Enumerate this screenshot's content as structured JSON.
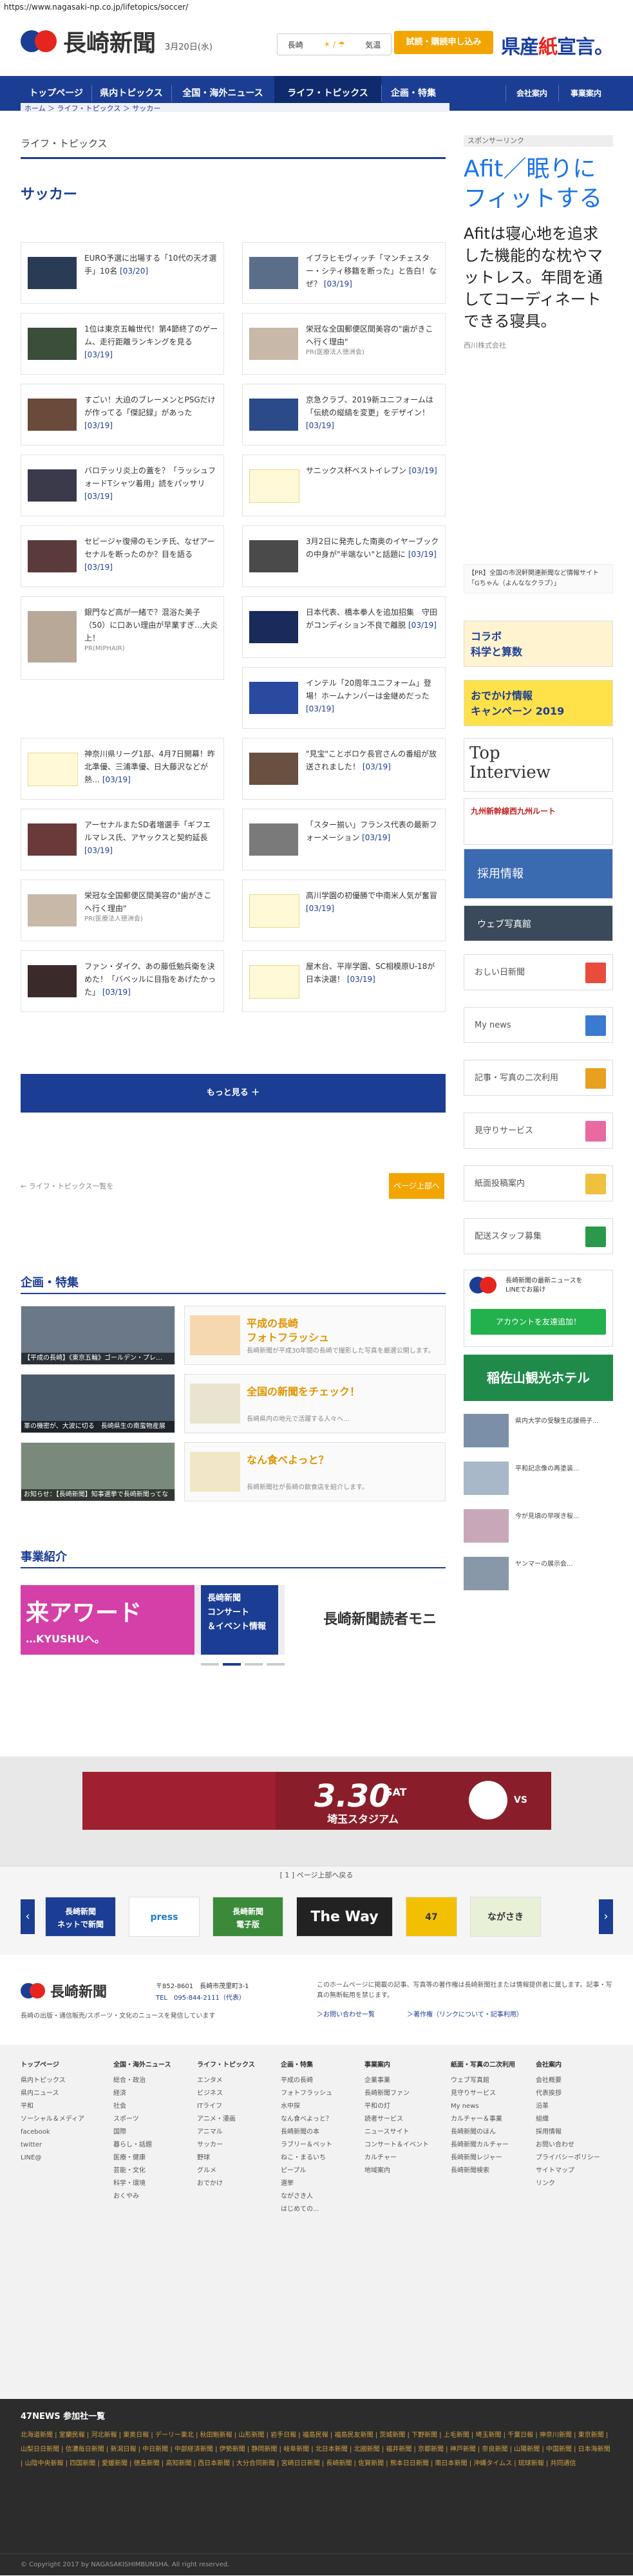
{
  "url": "https://www.nagasaki-np.co.jp/lifetopics/soccer/",
  "header": {
    "logo_text": "長崎新聞",
    "date": "3月20日(水)",
    "weather": [
      "長崎",
      "☀ / ☂",
      "気温"
    ],
    "trial_button": "試読・購読申し込み",
    "promo_a": "県産",
    "promo_b": "紙",
    "promo_c": "宣言。"
  },
  "nav": {
    "items": [
      "トップページ",
      "県内トピックス",
      "全国・海外ニュース",
      "ライフ・トピックス",
      "企画・特集",
      "会社案内",
      "事業案内"
    ]
  },
  "breadcrumb": "ホーム ＞ ライフ・トピックス ＞ サッカー",
  "section_title": "ライフ・トピックス",
  "page_title": "サッカー",
  "articles": [
    {
      "text": "EURO予選に出場する「10代の天才選手」10名",
      "date": "[03/20]"
    },
    {
      "text": "イブラヒモヴィッチ「マンチェスター・シティ移籍を断った」と告白！なぜ？",
      "date": "[03/19]"
    },
    {
      "text": "1位は東京五輪世代！第4節終了のゲーム、走行距離ランキングを見る",
      "date": "[03/19]"
    },
    {
      "text": "栄冠な全国郵便区間美容の\"歯がきこへ行く理由\"",
      "date": "",
      "pr": "PR(医療法人徳洲会)"
    },
    {
      "text": "すごい！大迫のブレーメンとPSGだけが作ってる「傑記録」があった",
      "date": "[03/19]"
    },
    {
      "text": "京急クラブ、2019新ユニフォームは「伝統の縦縞を変更」をデザイン！",
      "date": "[03/19]"
    },
    {
      "text": "バロテッリ炎上の蓋を？「ラッシュフォードTシャツ着用」読をパッサリ",
      "date": "[03/19]"
    },
    {
      "text": "サニックス杯ベストイレブン",
      "date": "[03/19]"
    },
    {
      "text": "セビージャ復帰のモンチ氏、なぜアーセナルを断ったのか？目を語る",
      "date": "[03/19]"
    },
    {
      "text": "3月2日に発売した南奥のイヤーブックの中身が\"半端ない\"と話題に",
      "date": "[03/19]"
    },
    {
      "text": "銀門など高が一緒で？混浴た美子（50）に口あい理由が早業すぎ…大炎上！",
      "date": "",
      "pr": "PR(MIPHAIR)"
    },
    {
      "text": "日本代表、橋本拳人を追加招集　守田がコンディション不良で離脱",
      "date": "[03/19]"
    },
    {
      "text": "インテル「20周年ユニフォーム」登場！ホームナンバーは金継めだった",
      "date": "[03/19]"
    },
    {
      "text": "神奈川県リーグ1部、4月7日開幕！昨北準優、三浦準優、日大藤沢などが熱…",
      "date": "[03/19]"
    },
    {
      "text": "\"見宝\"ことボロケ長官さんの番組が放送されました！",
      "date": "[03/19]"
    },
    {
      "text": "アーセナルまたSD者増選手「ギフエルマレス氏、アヤックスと契約延長",
      "date": "[03/19]"
    },
    {
      "text": "「スター揃い」フランス代表の最新フォーメーション",
      "date": "[03/19]"
    },
    {
      "text": "栄冠な全国郵便区間美容の\"歯がきこへ行く理由\"",
      "date": "",
      "pr": "PR(医療法人徳洲会)"
    },
    {
      "text": "高川学園の初優勝で中南米人気が奮冒",
      "date": "[03/19]"
    },
    {
      "text": "ファン・ダイク、あの藤低勉兵衛を決めた！「バベッルに目指をあげたかった」",
      "date": "[03/19]"
    },
    {
      "text": "屋木台、平岸学園、SC相模原U-18が日本決選！",
      "date": "[03/19]"
    }
  ],
  "more_button": "もっと見る ＋",
  "back_link": "← ライフ・トピックス一覧を",
  "page_top": "ページ上部へ",
  "features": {
    "heading": "企画・特集",
    "items": [
      {
        "caption": "【平成の長崎】《東京五輪》ゴールデン・プレ…　[03/17]",
        "title": "平成の長崎\nフォトフラッシュ",
        "desc": "長崎新聞が平成30年間の長崎で撮影した写真を厳選公開します。"
      },
      {
        "caption": "軍の機密が、大波に切る　長崎県生の南蛮物産展　実施物トラック　[03/19]",
        "title": "全国の新聞をチェック！",
        "desc": "長崎県内の地元で活躍する人々へ..."
      },
      {
        "caption": "お知らせ：【長崎新聞】知事選挙で長崎新聞ってなに？…",
        "title": "なん食べよっと？",
        "desc": "長崎新聞社が長崎の飲食店を紹介します。"
      }
    ]
  },
  "business": {
    "heading": "事業紹介",
    "banner_left": "来アワード",
    "banner_left_sub": "…KYUSHUへ。",
    "banner_mid": "長崎新聞\nコンサート\n＆イベント情報",
    "banner_right": "長崎新聞読者モニタ"
  },
  "ad": {
    "big": "3.30",
    "day": "SAT",
    "venue": "埼玉スタジアム"
  },
  "pager": "[ 1 ] ページ上部へ戻る",
  "partners": [
    "長崎新聞\nネットで新聞",
    "press",
    "長崎新聞\n電子版",
    "The Way",
    "47",
    "ながさき"
  ],
  "footer": {
    "address": "〒852-8601　長崎市茂里町3-1",
    "tel": "TEL　095-844-2111（代表）",
    "tagline": "長崎の出版・通信販売/スポーツ・文化のニュースを発信しています",
    "notice": "このホームページに掲載の記事、写真等の著作権は長崎新聞社または情報提供者に属します。記事・写真の無断転用を禁じます。",
    "link1": "＞お問い合わせ一覧",
    "link2": "＞著作権（リンクについて・記事利用）"
  },
  "footer_menu": [
    {
      "head": "トップページ",
      "items": [
        "県内トピックス",
        "県内ニュース",
        "平和",
        "ソーシャル＆メディア",
        "facebook",
        "twitter",
        "LINE@"
      ]
    },
    {
      "head": "全国・海外ニュース",
      "items": [
        "総合・政治",
        "経済",
        "社会",
        "スポーツ",
        "国際",
        "暮らし・話題",
        "医療・健康",
        "芸能・文化",
        "科学・環境",
        "おくやみ"
      ]
    },
    {
      "head": "ライフ・トピックス",
      "items": [
        "エンタメ",
        "ビジネス",
        "ITライフ",
        "アニメ・漫画",
        "アニマル",
        "サッカー",
        "野球",
        "グルメ",
        "おでかけ"
      ]
    },
    {
      "head": "企画・特集",
      "items": [
        "平成の長崎",
        "フォトフラッシュ",
        "水中探",
        "なん食べよっと？",
        "長崎新聞の本",
        "ラブリー＆ペット",
        "ねこ・まるいち",
        "ピープル",
        "選挙",
        "ながさき人",
        "はじめての..."
      ]
    },
    {
      "head": "事業案内",
      "items": [
        "企業事業",
        "長崎新聞ファン",
        "平和の灯",
        "読者サービス",
        "ニュースサイト",
        "コンサート＆イベント",
        "カルチャー",
        "地域案内"
      ]
    },
    {
      "head": "紙面・写真の二次利用",
      "items": [
        "ウェブ写真館",
        "見守りサービス",
        "My news",
        "カルチャー＆事業",
        "長崎新聞のほん",
        "長崎新聞カルチャー",
        "長崎新聞レジャー",
        "長崎新聞検索"
      ]
    },
    {
      "head": "会社案内",
      "items": [
        "会社概要",
        "代表挨拶",
        "沿革",
        "組織",
        "採用情報",
        "お問い合わせ",
        "プライバシーポリシー",
        "サイトマップ",
        "リンク"
      ]
    }
  ],
  "news47": {
    "heading": "47NEWS 参加社一覧",
    "list": "北海道新聞 | 室蘭民報 | 河北新報 | 東奥日報 | デーリー東北 | 秋田魁新報 | 山形新聞 | 岩手日報 | 福島民報 | 福島民友新聞 | 茨城新聞 | 下野新聞 | 上毛新聞 | 埼玉新聞 | 千葉日報 | 神奈川新聞 | 東京新聞 | 山梨日日新聞 | 信濃毎日新聞 | 新潟日報 | 中日新聞 | 中部経済新聞 | 伊勢新聞 | 静岡新聞 | 岐阜新聞 | 北日本新聞 | 北國新聞 | 福井新聞 | 京都新聞 | 神戸新聞 | 奈良新聞 | 山陽新聞 | 中国新聞 | 日本海新聞 | 山陰中央新報 | 四国新聞 | 愛媛新聞 | 徳島新聞 | 高知新聞 | 西日本新聞 | 大分合同新聞 | 宮崎日日新聞 | 長崎新聞 | 佐賀新聞 | 熊本日日新聞 | 南日本新聞 | 沖縄タイムス | 琉球新報 | 共同通信"
  },
  "copyright": "© Copyright 2017 by NAGASAKISHIMBUNSHA. All right reserved.",
  "sidebar": {
    "sponsor_label": "スポンサーリンク",
    "ad_headline": "Afit／眠りにフィットする",
    "ad_body": "Afitは寝心地を追求した機能的な枕やマットレス。年間を通してコーディネートできる寝具。",
    "ad_sponsor": "西川株式会社",
    "notice": "【PR】全国の市況軒関連新聞など情報サイト「Gちゃん（よんななクラブ）」",
    "banners": [
      "コラボ\n科学と算数",
      "おでかけ情報\nキャンペーン 2019",
      "Top\nInterview",
      "九州新幹線西九州ルート",
      "採用情報",
      "ウェブ写真館"
    ],
    "buttons": [
      "おしい日新聞",
      "My news",
      "記事・写真の二次利用",
      "見守りサービス",
      "紙面投稿案内",
      "配送スタッフ募集"
    ],
    "line_label": "長崎新聞の最新ニュースを\nLINEでお届け",
    "line_button": "アカウントを友達追加！",
    "hotel": "稲佐山観光ホテル",
    "small_items": [
      "県内大学の受験生応援冊子...",
      "平和記念像の再塗装...",
      "今が見頃の早咲き桜...",
      "ヤンマーの展示会..."
    ]
  }
}
